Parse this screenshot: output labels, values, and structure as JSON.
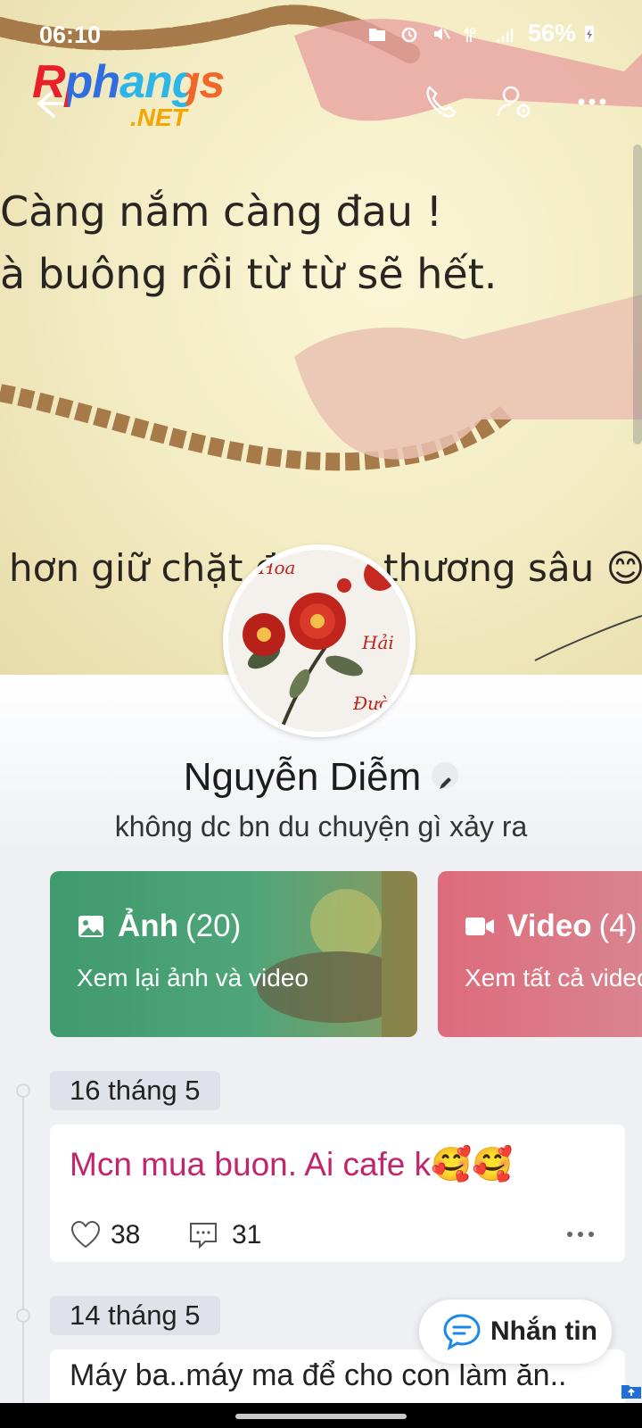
{
  "status_bar": {
    "time": "06:10",
    "battery": "56%"
  },
  "watermark": {
    "line1": "Rphangs",
    "line2": ".NET"
  },
  "cover": {
    "lines": [
      "Càng nắm càng đau !",
      "à buông rồi từ từ sẽ hết.",
      "hơn giữ chặt đoạ",
      "thương sâu 😊"
    ],
    "avatar_texts": [
      "Hoa",
      "Hải",
      "Đườn"
    ]
  },
  "profile": {
    "name": "Nguyễn Diễm",
    "status": "không dc bn du chuyện gì xảy ra"
  },
  "cards": [
    {
      "title": "Ảnh",
      "count": "(20)",
      "subtitle": "Xem lại ảnh và video",
      "color": "#4a9f74"
    },
    {
      "title": "Video",
      "count": "(4)",
      "subtitle": "Xem tất cả video",
      "color": "#de6e7d"
    }
  ],
  "timeline": [
    {
      "date": "16 tháng 5",
      "text": "Mcn mua buon. Ai cafe k🥰🥰",
      "text_color": "#c2256b",
      "likes": "38",
      "comments": "31"
    },
    {
      "date": "14 tháng 5",
      "text": "Máy ba..máy ma để cho con làm ăn..",
      "text_color": "#222222"
    }
  ],
  "fab": {
    "label": "Nhắn tin"
  }
}
